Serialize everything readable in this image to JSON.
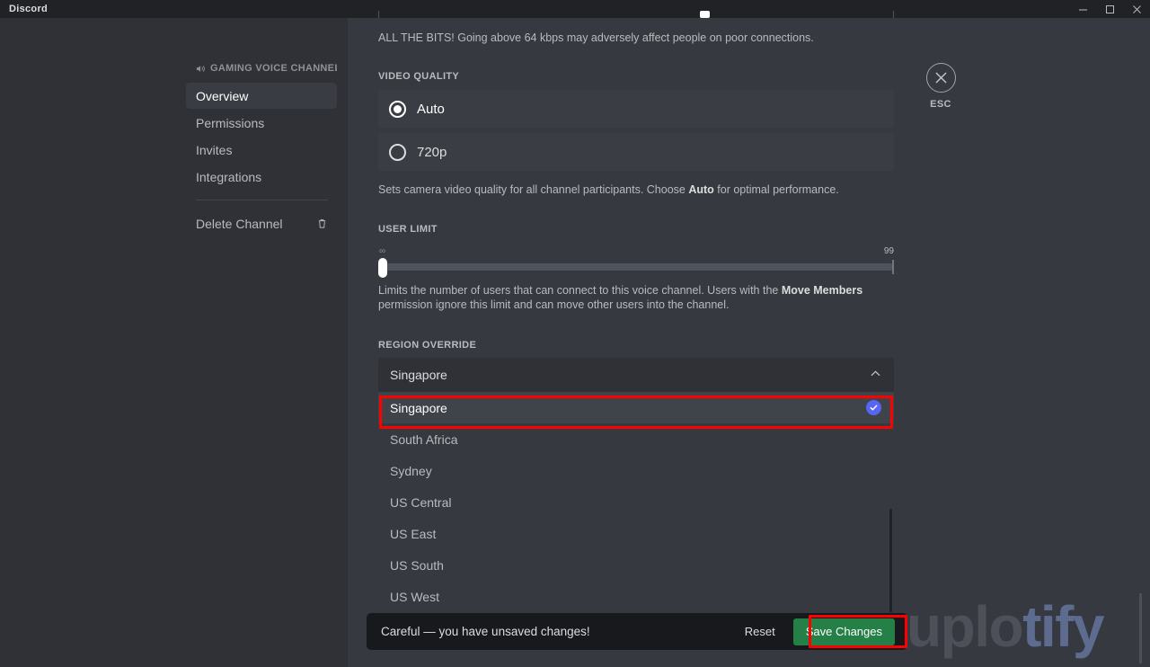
{
  "window": {
    "title": "Discord",
    "controls": [
      {
        "name": "minimize",
        "glyph": "minimize-icon"
      },
      {
        "name": "maximize",
        "glyph": "maximize-icon"
      },
      {
        "name": "close",
        "glyph": "close-icon"
      }
    ]
  },
  "sidebar": {
    "header": "GAMING VOICE CHANNELS",
    "header_icon": "speaker-icon",
    "items": [
      {
        "label": "Overview",
        "active": true
      },
      {
        "label": "Permissions",
        "active": false
      },
      {
        "label": "Invites",
        "active": false
      },
      {
        "label": "Integrations",
        "active": false
      }
    ],
    "danger": {
      "label": "Delete Channel",
      "icon": "trash-icon"
    }
  },
  "content": {
    "bitrate_helper": "ALL THE BITS! Going above 64 kbps may adversely affect people on poor connections.",
    "video_quality": {
      "label": "VIDEO QUALITY",
      "options": [
        {
          "label": "Auto",
          "checked": true
        },
        {
          "label": "720p",
          "checked": false
        }
      ],
      "helper_before": "Sets camera video quality for all channel participants. Choose ",
      "helper_bold": "Auto",
      "helper_after": " for optimal performance."
    },
    "user_limit": {
      "label": "USER LIMIT",
      "min_label": "∞",
      "max_label": "99",
      "value": 0,
      "helper_before": "Limits the number of users that can connect to this voice channel. Users with the ",
      "helper_bold": "Move Members",
      "helper_after": " permission ignore this limit and can move other users into the channel."
    },
    "region_override": {
      "label": "REGION OVERRIDE",
      "selected": "Singapore",
      "chevron_icon": "chevron-up-icon",
      "options": [
        {
          "label": "Singapore",
          "selected": true
        },
        {
          "label": "South Africa",
          "selected": false
        },
        {
          "label": "Sydney",
          "selected": false
        },
        {
          "label": "US Central",
          "selected": false
        },
        {
          "label": "US East",
          "selected": false
        },
        {
          "label": "US South",
          "selected": false
        },
        {
          "label": "US West",
          "selected": false
        }
      ]
    }
  },
  "close": {
    "icon": "close-circle-icon",
    "label": "ESC"
  },
  "savebar": {
    "message": "Careful — you have unsaved changes!",
    "reset_label": "Reset",
    "save_label": "Save Changes"
  },
  "watermark": {
    "part_a": "uplo",
    "part_b": "tify"
  },
  "colors": {
    "accent_blue": "#5865f2",
    "save_green": "#248046",
    "highlight_red": "#ff0000",
    "sidebar_bg": "#2f3136",
    "content_bg": "#36393f",
    "titlebar_bg": "#202225"
  }
}
